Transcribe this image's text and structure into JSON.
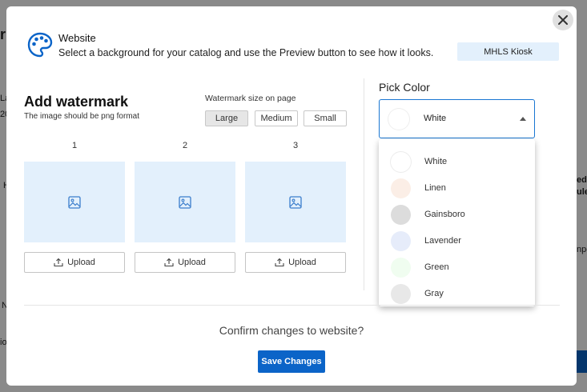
{
  "background": {
    "fragments": [
      "r",
      "La",
      "20",
      "H",
      "N",
      "io",
      "ed:",
      "ule",
      "npo"
    ]
  },
  "header": {
    "icon": "palette-icon",
    "title": "Website",
    "subtitle": "Select a background for your catalog and use the Preview button to see how it looks.",
    "kiosk_button": "MHLS Kiosk"
  },
  "watermark": {
    "title": "Add watermark",
    "subtitle": "The image should be png format",
    "size_label": "Watermark size on page",
    "sizes": [
      "Large",
      "Medium",
      "Small"
    ],
    "selected_size": "Large",
    "slots": [
      {
        "number": "1",
        "upload_label": "Upload"
      },
      {
        "number": "2",
        "upload_label": "Upload"
      },
      {
        "number": "3",
        "upload_label": "Upload"
      }
    ]
  },
  "color_picker": {
    "label": "Pick Color",
    "selected": "White",
    "selected_color": "#ffffff",
    "options": [
      {
        "name": "White",
        "color": "#ffffff"
      },
      {
        "name": "Linen",
        "color": "#fbeee6"
      },
      {
        "name": "Gainsboro",
        "color": "#dcdcdc"
      },
      {
        "name": "Lavender",
        "color": "#e6ecfa"
      },
      {
        "name": "Green",
        "color": "#f0fdf0"
      },
      {
        "name": "Gray",
        "color": "#e8e8e8"
      }
    ]
  },
  "footer": {
    "confirm_text": "Confirm changes to website?",
    "save_button": "Save Changes"
  },
  "colors": {
    "accent": "#0b64c8",
    "light_blue": "#e3f0fc"
  }
}
